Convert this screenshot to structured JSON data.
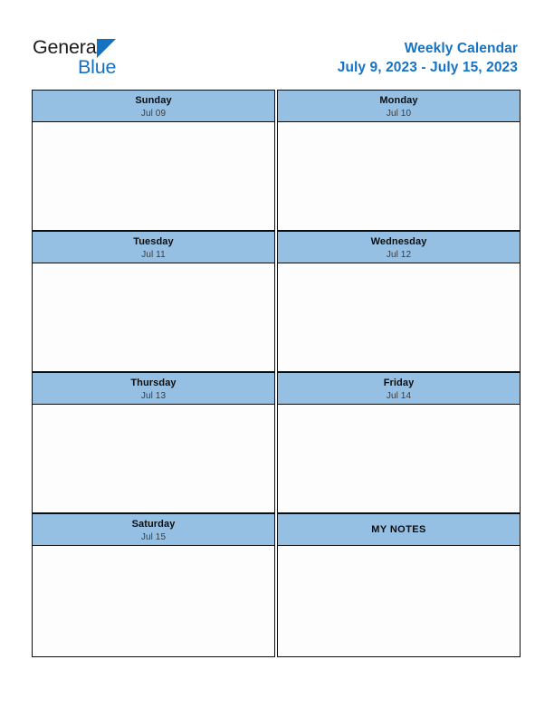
{
  "brand": {
    "name_part1": "General",
    "name_part2": "Blue",
    "logo_icon": "blue-triangle-icon",
    "accent_color": "#1572c0"
  },
  "header": {
    "title": "Weekly Calendar",
    "date_range": "July 9, 2023 - July 15, 2023",
    "title_color": "#1573c6"
  },
  "theme": {
    "header_cell_background": "#95c0e4",
    "border_color": "#0d0d0d",
    "body_cell_background": "#fdfdfd",
    "page_background": "#ffffff"
  },
  "calendar": {
    "cells": [
      {
        "day": "Sunday",
        "date": "Jul 09",
        "content": ""
      },
      {
        "day": "Monday",
        "date": "Jul 10",
        "content": ""
      },
      {
        "day": "Tuesday",
        "date": "Jul 11",
        "content": ""
      },
      {
        "day": "Wednesday",
        "date": "Jul 12",
        "content": ""
      },
      {
        "day": "Thursday",
        "date": "Jul 13",
        "content": ""
      },
      {
        "day": "Friday",
        "date": "Jul 14",
        "content": ""
      },
      {
        "day": "Saturday",
        "date": "Jul 15",
        "content": ""
      },
      {
        "day": "MY NOTES",
        "date": "",
        "content": ""
      }
    ]
  }
}
